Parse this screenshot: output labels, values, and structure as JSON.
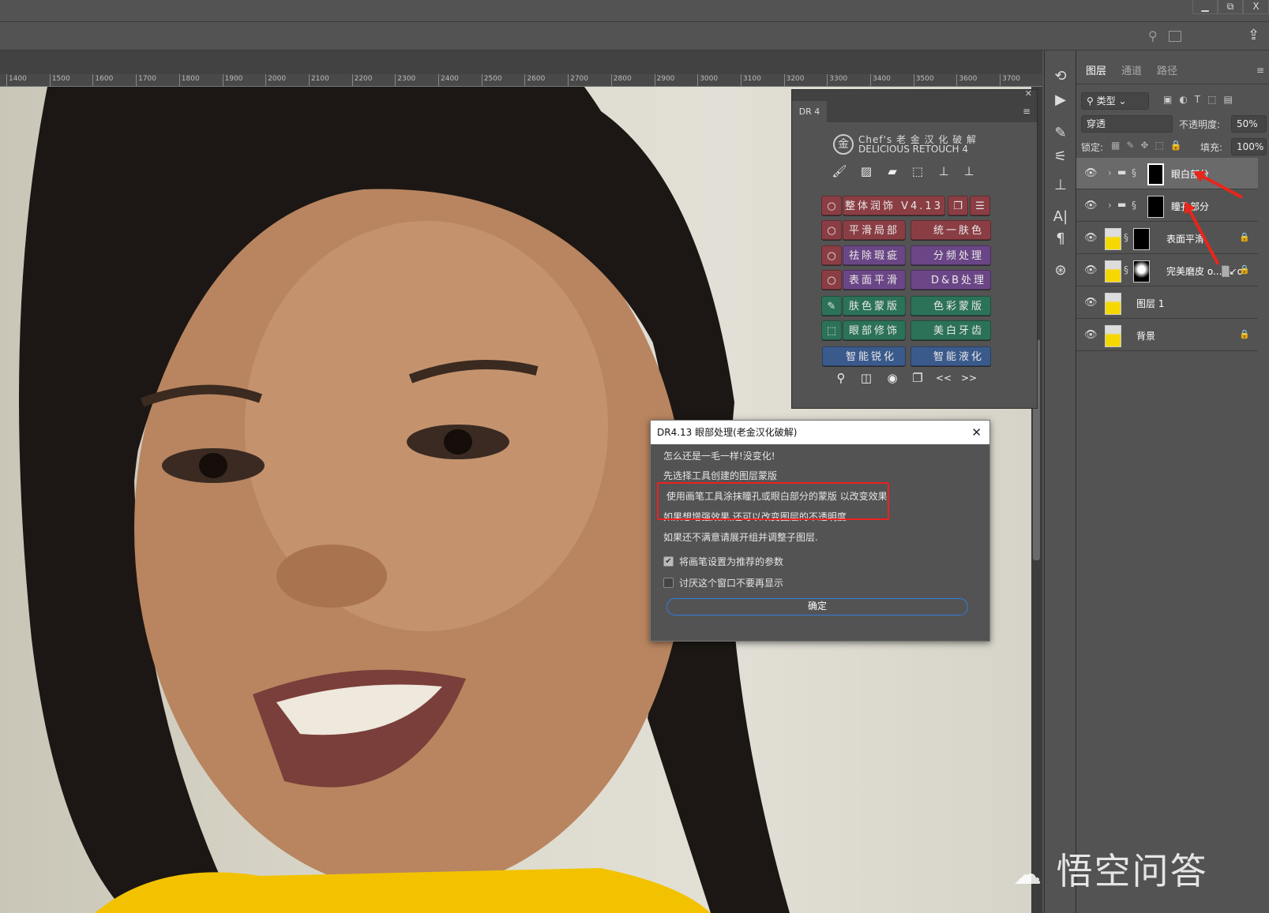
{
  "window": {
    "minimize": "▁",
    "restore": "⧉",
    "close": "X"
  },
  "optbar": {
    "icons": [
      "search-icon",
      "workspace-icon",
      "share-icon"
    ]
  },
  "ruler": {
    "ticks": [
      "1400",
      "1500",
      "1600",
      "1700",
      "1800",
      "1900",
      "2000",
      "2100",
      "2200",
      "2300",
      "2400",
      "2500",
      "2600",
      "2700",
      "2800",
      "2900",
      "3000",
      "3100",
      "3200",
      "3300",
      "3400",
      "3500",
      "3600",
      "3700"
    ]
  },
  "dr_panel": {
    "tab": "DR 4",
    "logo_line1": "Chef's 老 金 汉 化 破 解",
    "logo_line2": "DELICIOUS RETOUCH 4",
    "logo_glyph": "金",
    "top_icons": [
      "brush-icon",
      "bandage-dots-icon",
      "bandage-icon",
      "selection-icon",
      "stamp-icon",
      "stamp-dots-icon"
    ],
    "buttons": {
      "overall": "整体润饰 V4.13",
      "smooth_local": "平滑局部",
      "unify_skin": "统一肤色",
      "remove_blemish": "祛除瑕疵",
      "frequency": "分频处理",
      "surface_smooth": "表面平滑",
      "db": "D&B处理",
      "skin_mask": "肤色蒙版",
      "color_mask": "色彩蒙版",
      "eye": "眼部修饰",
      "teeth": "美白牙齿",
      "sharpen": "智能锐化",
      "liquify": "智能液化"
    },
    "bottom_icons": {
      "prev": "<<",
      "next": ">>"
    }
  },
  "dialog": {
    "title": "DR4.13 眼部处理(老金汉化破解)",
    "lines": [
      "怎么还是一毛一样!没变化!",
      "先选择工具创建的图层蒙版",
      " 使用画笔工具涂抹瞳孔或眼白部分的蒙版 以改变效果",
      "如果想增强效果,还可以改变图层的不透明度",
      "如果还不满意请展开组并调整子图层."
    ],
    "checkbox1": {
      "label": "将画笔设置为推荐的参数",
      "checked": true
    },
    "checkbox2": {
      "label": "讨厌这个窗口不要再显示",
      "checked": false
    },
    "ok": "确定"
  },
  "layers_panel": {
    "tabs": [
      "图层",
      "通道",
      "路径"
    ],
    "filter": "类型",
    "blend": "穿透",
    "opacity_label": "不透明度:",
    "opacity": "50%",
    "lock_label": "锁定:",
    "fill_label": "填充:",
    "fill": "100%",
    "layers": [
      {
        "name": "眼白部分",
        "type": "group",
        "selected": true,
        "locked": false
      },
      {
        "name": "瞳孔部分",
        "type": "group",
        "selected": false,
        "locked": false
      },
      {
        "name": "表面平滑",
        "type": "layer-mask",
        "selected": false,
        "locked": true
      },
      {
        "name": "完美磨皮 o...▒↙o",
        "type": "layer-mask",
        "selected": false,
        "locked": true
      },
      {
        "name": "图层 1",
        "type": "layer",
        "selected": false,
        "locked": false
      },
      {
        "name": "背景",
        "type": "layer",
        "selected": false,
        "locked": true
      }
    ]
  },
  "watermark": "悟空问答",
  "colors": {
    "red_btn": "#8a3e44",
    "purple_btn": "#6b4686",
    "green_btn": "#2c7258",
    "blue_btn": "#3b5a8c",
    "highlight": "#ee2020",
    "arrow": "#e8261c"
  }
}
